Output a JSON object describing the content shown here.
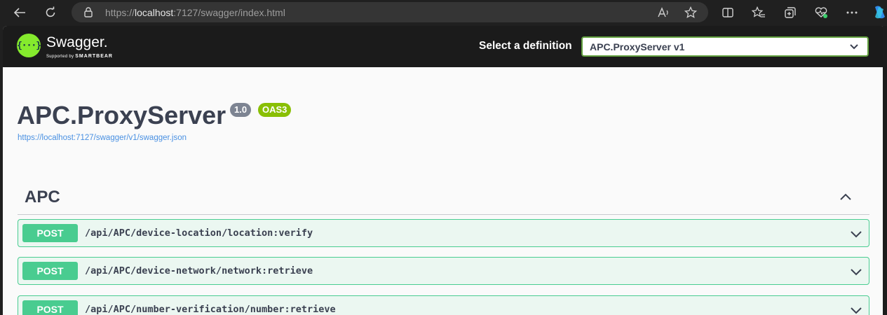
{
  "browser": {
    "url_prefix": "https://",
    "url_host": "localhost",
    "url_rest": ":7127/swagger/index.html"
  },
  "topbar": {
    "logo_symbol": "{···}",
    "logo_name": "Swagger.",
    "logo_supported": "Supported by",
    "logo_company": "SMARTBEAR",
    "select_label": "Select a definition",
    "select_value": "APC.ProxyServer v1"
  },
  "info": {
    "title": "APC.ProxyServer",
    "version": "1.0",
    "oas": "OAS3",
    "spec_url": "https://localhost:7127/swagger/v1/swagger.json"
  },
  "tag": {
    "name": "APC"
  },
  "operations": [
    {
      "method": "POST",
      "path": "/api/APC/device-location/location:verify"
    },
    {
      "method": "POST",
      "path": "/api/APC/device-network/network:retrieve"
    },
    {
      "method": "POST",
      "path": "/api/APC/number-verification/number:retrieve"
    }
  ],
  "colors": {
    "post": "#49cc90",
    "post_bg": "#ebf7f1",
    "topbar": "#1b1b1b",
    "logo": "#85ea2d",
    "link": "#4990e2"
  }
}
